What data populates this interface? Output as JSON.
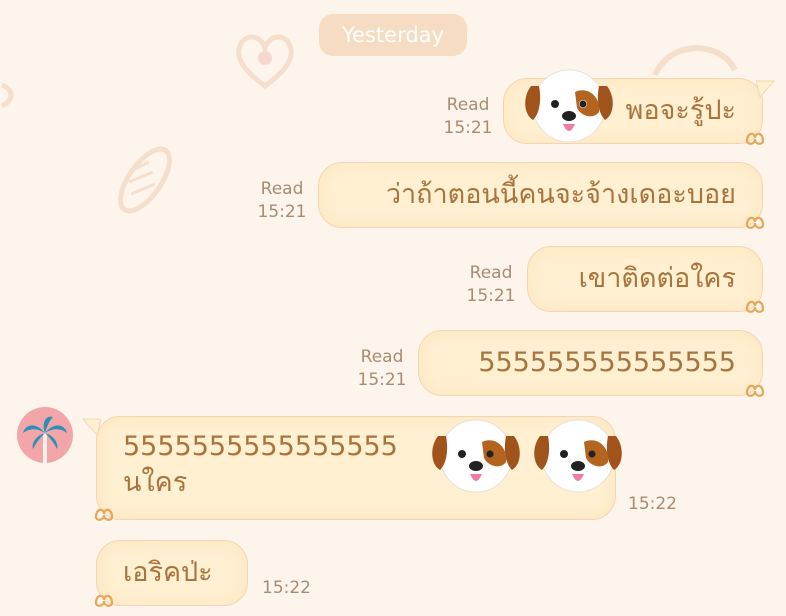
{
  "date_separator": "Yesterday",
  "messages": [
    {
      "text": "พอจะรู้ปะ",
      "read": "Read",
      "time": "15:21"
    },
    {
      "text": "ว่าถ้าตอนนี้คนจะจ้างเดอะบอย",
      "read": "Read",
      "time": "15:21"
    },
    {
      "text": "เขาติดต่อใคร",
      "read": "Read",
      "time": "15:21"
    },
    {
      "text": "555555555555555",
      "read": "Read",
      "time": "15:21"
    },
    {
      "text_line1": "5555555555555555",
      "text_line2": "นใคร",
      "time": "15:22"
    },
    {
      "text": "เอริคป่ะ",
      "time": "15:22"
    }
  ],
  "icons": {
    "emoji": "dog-face-sticker",
    "avatar": "palm-tree-icon",
    "bubble_corner": "pretzel-icon"
  },
  "colors": {
    "background": "#fdf5ec",
    "bubble": "#fff0d2",
    "bubble_text": "#a9733c",
    "meta_text": "#a98c70",
    "date_pill": "#f6dcc2",
    "avatar_bg": "#f2a6aa",
    "palm": "#2f8fb3"
  }
}
